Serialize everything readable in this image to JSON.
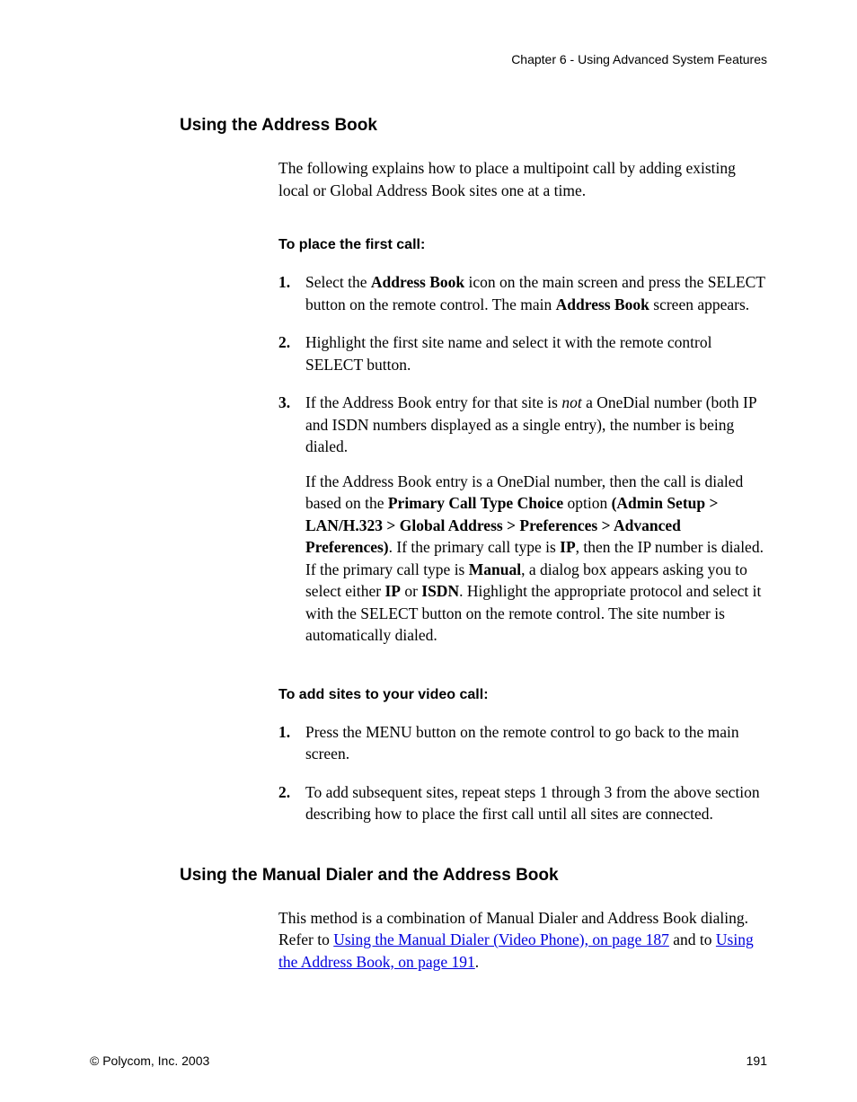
{
  "header": {
    "chapter": "Chapter 6 - Using Advanced System Features"
  },
  "sections": {
    "addressBook": {
      "heading": "Using the Address Book",
      "intro": "The following explains how to place a multipoint call by adding existing local or Global Address Book sites one at a time.",
      "sub1": {
        "heading": "To place the first call:",
        "step1a": "Select the ",
        "step1b": "Address Book",
        "step1c": " icon on the main screen and press the SELECT button on the remote control. The main ",
        "step1d": "Address Book",
        "step1e": " screen appears.",
        "step2": "Highlight the first site name and select it with the remote control SELECT button.",
        "step3a": "If the Address Book entry for that site is ",
        "step3not": "not",
        "step3b": " a OneDial number (both IP and ISDN numbers displayed as a single entry), the number is being dialed.",
        "step3p2a": "If the Address Book entry is a OneDial number, then the call is dialed based on the ",
        "step3p2b": "Primary Call Type Choice",
        "step3p2c": " option ",
        "step3p2d": "(Admin Setup > LAN/H.323 > Global Address > Preferences > Advanced Preferences)",
        "step3p2e": ". If the primary call type is ",
        "step3p2f": "IP",
        "step3p2g": ", then the IP number is dialed. If the primary call type is ",
        "step3p2h": "Manual",
        "step3p2i": ", a dialog box appears asking you to select either ",
        "step3p2j": "IP",
        "step3p2k": " or ",
        "step3p2l": "ISDN",
        "step3p2m": ". Highlight the appropriate protocol and select it with the SELECT button on the remote control. The site number is automatically dialed."
      },
      "sub2": {
        "heading": "To add sites to your video call:",
        "step1": "Press the MENU button on the remote control to go back to the main screen.",
        "step2": "To add subsequent sites, repeat steps 1 through 3 from the above section describing how to place the first call until all sites are connected."
      }
    },
    "manualDialer": {
      "heading": "Using the Manual Dialer and the Address Book",
      "introA": "This method is a combination of Manual Dialer and Address Book dialing. Refer to ",
      "link1": "Using the Manual Dialer (Video Phone), on page 187",
      "introB": " and to ",
      "link2": "Using the Address Book, on page 191",
      "introC": "."
    }
  },
  "footer": {
    "copyright": "© Polycom, Inc. 2003",
    "pageNumber": "191"
  }
}
